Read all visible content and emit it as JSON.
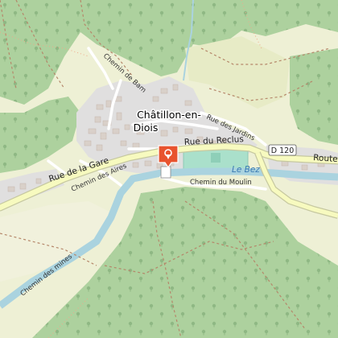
{
  "map": {
    "town": {
      "line1": "Châtillon-en-",
      "line2": "Diois"
    },
    "roads": {
      "rue_de_la_gare": "Rue de la Gare",
      "rue_du_reclus": "Rue du Reclus",
      "route": "Route",
      "d120": "D 120",
      "chemin_des_aires": "Chemin des Aires",
      "chemin_du_moulin": "Chemin du Moulin",
      "rue_des_jardins": "Rue des Jardins",
      "chemin_de_bam": "Chemin de Bam",
      "chemin_des_mines": "Chemin des mines"
    },
    "water": {
      "river": "Le Bez"
    },
    "marker": {
      "icon": "location-pin-icon",
      "color": "#e8532e"
    },
    "colors": {
      "forest": "#add19e",
      "meadow": "#cdebb0",
      "farmland": "#eef0d5",
      "residential": "#e0dfdf",
      "building": "#d9d0c9",
      "water": "#aad3df",
      "road_secondary": "#f7fabf",
      "sports": "#aae0cb"
    }
  }
}
